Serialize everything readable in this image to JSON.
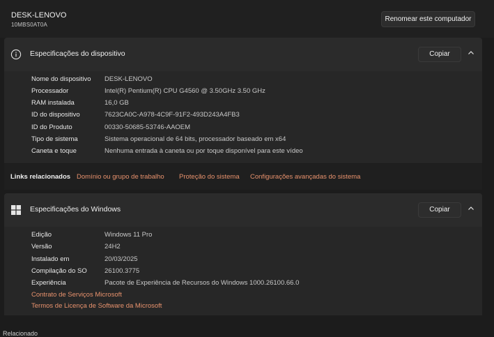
{
  "header": {
    "pc_name": "DESK-LENOVO",
    "pc_model": "10MBS0AT0A",
    "rename_button": "Renomear este computador"
  },
  "device_specs": {
    "title": "Especificações do dispositivo",
    "icon": "info-icon",
    "copy_label": "Copiar",
    "rows": [
      {
        "label": "Nome do dispositivo",
        "value": "DESK-LENOVO"
      },
      {
        "label": "Processador",
        "value": "Intel(R) Pentium(R) CPU G4560 @ 3.50GHz   3.50 GHz"
      },
      {
        "label": "RAM instalada",
        "value": "16,0 GB"
      },
      {
        "label": "ID do dispositivo",
        "value": "7623CA0C-A978-4C9F-91F2-493D243A4FB3"
      },
      {
        "label": "ID do Produto",
        "value": "00330-50685-53746-AAOEM"
      },
      {
        "label": "Tipo de sistema",
        "value": "Sistema operacional de 64 bits, processador baseado em x64"
      },
      {
        "label": "Caneta e toque",
        "value": "Nenhuma entrada à caneta ou por toque disponível para este vídeo"
      }
    ]
  },
  "related_links": {
    "title": "Links relacionados",
    "links": [
      "Domínio ou grupo de trabalho",
      "Proteção do sistema",
      "Configurações avançadas do sistema"
    ]
  },
  "windows_specs": {
    "title": "Especificações do Windows",
    "icon": "windows-logo-icon",
    "copy_label": "Copiar",
    "rows": [
      {
        "label": "Edição",
        "value": "Windows 11 Pro"
      },
      {
        "label": "Versão",
        "value": "24H2"
      },
      {
        "label": "Instalado em",
        "value": "20/03/2025"
      },
      {
        "label": "Compilação do SO",
        "value": "26100.3775"
      },
      {
        "label": "Experiência",
        "value": "Pacote de Experiência de Recursos do Windows 1000.26100.66.0"
      }
    ],
    "links": [
      "Contrato de Serviços Microsoft",
      "Termos de Licença de Software da Microsoft"
    ]
  },
  "bottom_partial_text": "Relacionado"
}
